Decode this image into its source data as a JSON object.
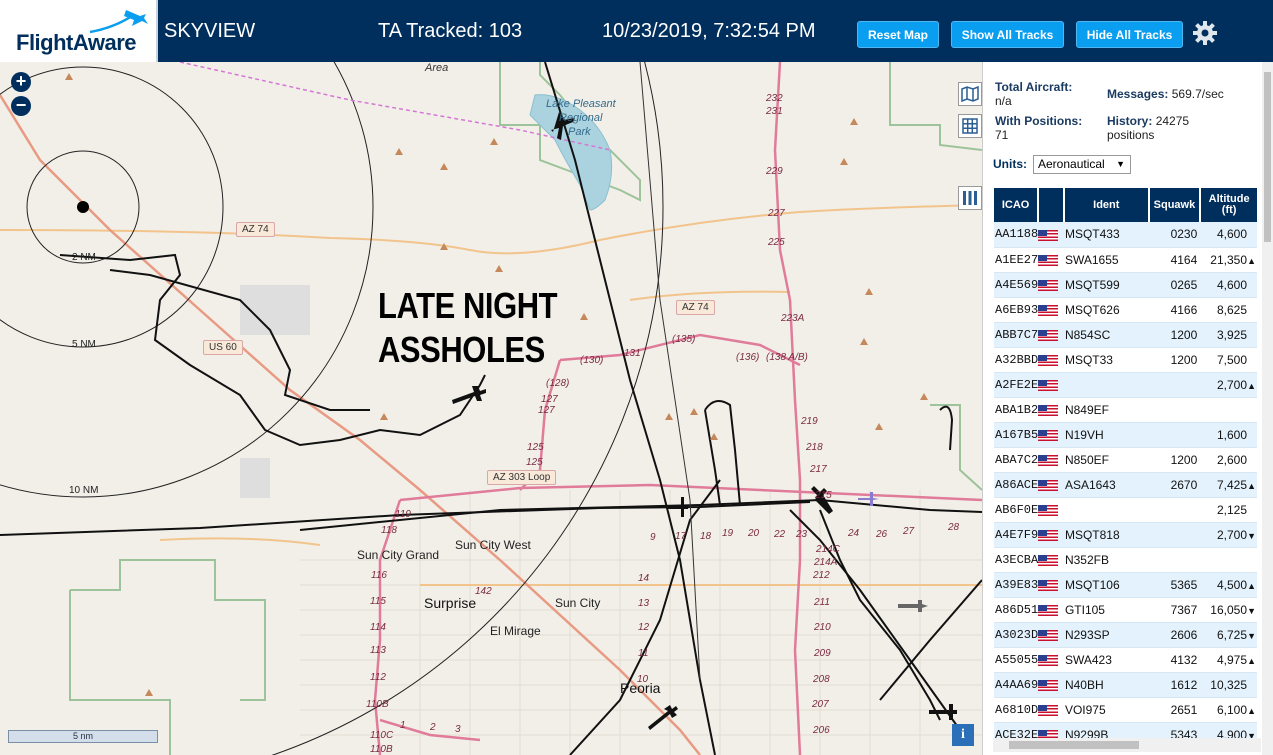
{
  "header": {
    "logo_text": "FlightAware",
    "app_name": "SKYVIEW",
    "tracked": "TA Tracked: 103",
    "datetime": "10/23/2019, 7:32:54 PM",
    "btn_reset": "Reset Map",
    "btn_show": "Show All Tracks",
    "btn_hide": "Hide All Tracks",
    "settings_icon": "gear-icon"
  },
  "map": {
    "annotation_line1": "LATE NIGHT",
    "annotation_line2": "ASSHOLES",
    "scale": "5 nm",
    "ranges": [
      "2 NM",
      "5 NM",
      "10 NM"
    ],
    "labels": {
      "area": "Area",
      "lake": "Lake Pleasant",
      "lake2": "Regional",
      "lake3": "Park",
      "sun_city_grand": "Sun City Grand",
      "sun_city_west": "Sun City West",
      "surprise": "Surprise",
      "sun_city": "Sun City",
      "el_mirage": "El Mirage",
      "peoria": "Peoria"
    },
    "shields": {
      "az74a": "AZ 74",
      "az74b": "AZ 74",
      "us60": "US 60",
      "az303": "AZ 303 Loop"
    },
    "road_numbers": [
      "(130)",
      "131",
      "(135)",
      "(136)",
      "(138 A/B)",
      "(128)",
      "127",
      "127",
      "125",
      "125",
      "119",
      "118",
      "116",
      "115",
      "114",
      "113",
      "112",
      "110B",
      "110C",
      "110B",
      "232",
      "231",
      "229",
      "227",
      "225",
      "223A",
      "219",
      "218",
      "217",
      "215",
      "214C",
      "214A",
      "212",
      "211",
      "210",
      "209",
      "208",
      "207",
      "206",
      "1",
      "2",
      "3",
      "142",
      "14",
      "13",
      "12",
      "11",
      "10",
      "9",
      "17",
      "18",
      "19",
      "20",
      "22",
      "23",
      "24",
      "26",
      "27",
      "28"
    ],
    "zoom_in": "+",
    "zoom_out": "−",
    "info": "i"
  },
  "panel": {
    "total_label": "Total Aircraft:",
    "total_value": "n/a",
    "messages_label": "Messages:",
    "messages_value": "569.7/sec",
    "with_pos_label": "With Positions:",
    "with_pos_value": "71",
    "history_label": "History:",
    "history_value": "24275",
    "history_unit": "positions",
    "units_label": "Units:",
    "units_value": "Aeronautical",
    "columns": [
      "ICAO",
      "",
      "Ident",
      "Squawk",
      "Altitude (ft)"
    ],
    "rows": [
      {
        "icao": "AA1188",
        "ident": "MSQT433",
        "squawk": "0230",
        "alt": "4,600",
        "trend": ""
      },
      {
        "icao": "A1EE27",
        "ident": "SWA1655",
        "squawk": "4164",
        "alt": "21,350",
        "trend": "▲"
      },
      {
        "icao": "A4E569",
        "ident": "MSQT599",
        "squawk": "0265",
        "alt": "4,600",
        "trend": ""
      },
      {
        "icao": "A6EB93",
        "ident": "MSQT626",
        "squawk": "4166",
        "alt": "8,625",
        "trend": ""
      },
      {
        "icao": "ABB7C7",
        "ident": "N854SC",
        "squawk": "1200",
        "alt": "3,925",
        "trend": ""
      },
      {
        "icao": "A32BBD",
        "ident": "MSQT33",
        "squawk": "1200",
        "alt": "7,500",
        "trend": ""
      },
      {
        "icao": "A2FE2E",
        "ident": "",
        "squawk": "",
        "alt": "2,700",
        "trend": "▲"
      },
      {
        "icao": "ABA1B2",
        "ident": "N849EF",
        "squawk": "",
        "alt": "",
        "trend": ""
      },
      {
        "icao": "A167B5",
        "ident": "N19VH",
        "squawk": "",
        "alt": "1,600",
        "trend": ""
      },
      {
        "icao": "ABA7C2",
        "ident": "N850EF",
        "squawk": "1200",
        "alt": "2,600",
        "trend": ""
      },
      {
        "icao": "A86ACE",
        "ident": "ASA1643",
        "squawk": "2670",
        "alt": "7,425",
        "trend": "▲"
      },
      {
        "icao": "AB6F0E",
        "ident": "",
        "squawk": "",
        "alt": "2,125",
        "trend": ""
      },
      {
        "icao": "A4E7F9",
        "ident": "MSQT818",
        "squawk": "",
        "alt": "2,700",
        "trend": "▼"
      },
      {
        "icao": "A3ECBA",
        "ident": "N352FB",
        "squawk": "",
        "alt": "",
        "trend": ""
      },
      {
        "icao": "A39E83",
        "ident": "MSQT106",
        "squawk": "5365",
        "alt": "4,500",
        "trend": "▲"
      },
      {
        "icao": "A86D51",
        "ident": "GTI105",
        "squawk": "7367",
        "alt": "16,050",
        "trend": "▼"
      },
      {
        "icao": "A3023D",
        "ident": "N293SP",
        "squawk": "2606",
        "alt": "6,725",
        "trend": "▼"
      },
      {
        "icao": "A55055",
        "ident": "SWA423",
        "squawk": "4132",
        "alt": "4,975",
        "trend": "▲"
      },
      {
        "icao": "A4AA69",
        "ident": "N40BH",
        "squawk": "1612",
        "alt": "10,325",
        "trend": ""
      },
      {
        "icao": "A6810D",
        "ident": "VOI975",
        "squawk": "2651",
        "alt": "6,100",
        "trend": "▲"
      },
      {
        "icao": "ACE32E",
        "ident": "N9299B",
        "squawk": "5343",
        "alt": "4,900",
        "trend": "▼"
      }
    ]
  },
  "colors": {
    "header_bg": "#002f5d",
    "button_bg": "#0a9ef0",
    "table_header": "#002f5d",
    "row_alt": "#e4f2fd"
  }
}
